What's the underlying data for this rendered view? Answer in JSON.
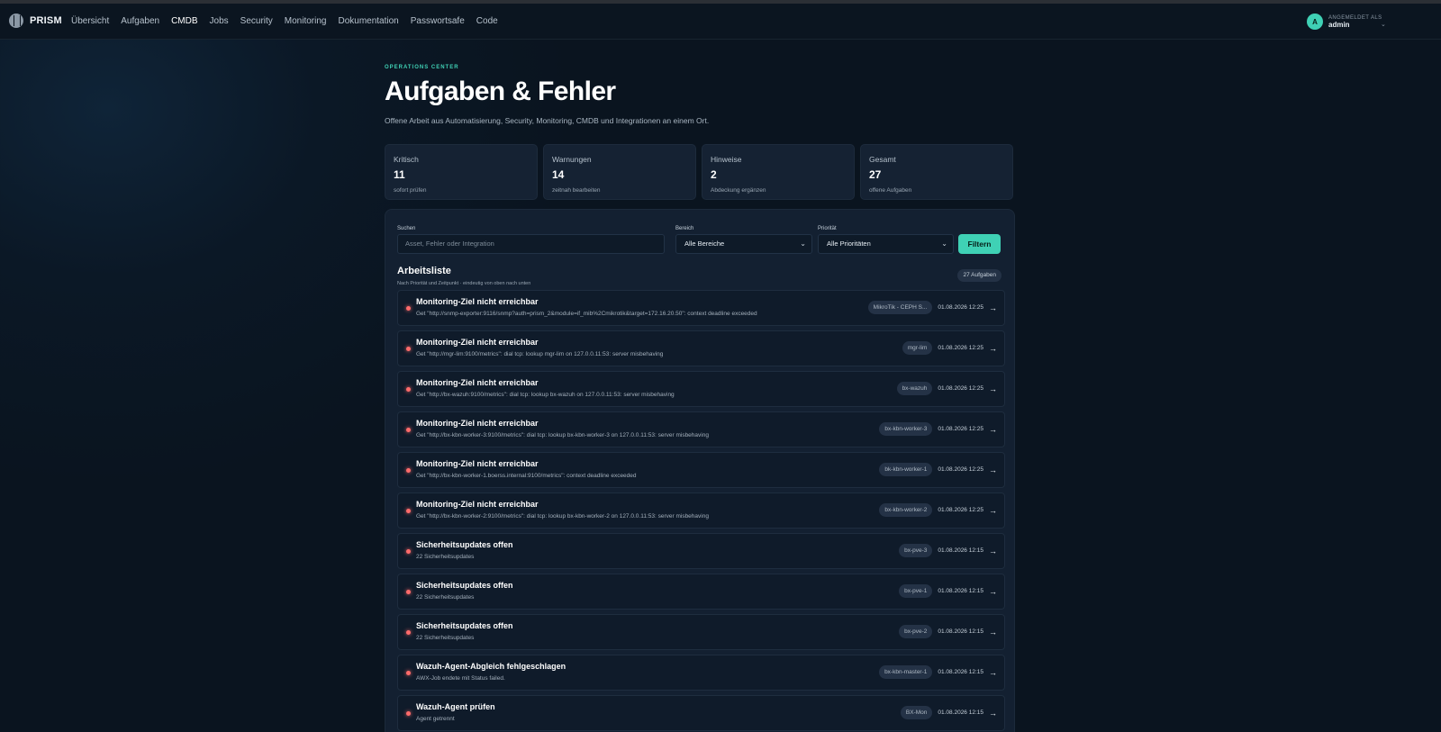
{
  "app": {
    "name": "PRISM"
  },
  "nav": [
    {
      "label": "Übersicht"
    },
    {
      "label": "Aufgaben"
    },
    {
      "label": "CMDB"
    },
    {
      "label": "Jobs"
    },
    {
      "label": "Security"
    },
    {
      "label": "Monitoring"
    },
    {
      "label": "Dokumentation"
    },
    {
      "label": "Passwortsafe"
    },
    {
      "label": "Code"
    }
  ],
  "user": {
    "initial": "A",
    "caption": "ANGEMELDET ALS",
    "name": "admin",
    "chevron": "⌄"
  },
  "header": {
    "eyebrow": "OPERATIONS CENTER",
    "title": "Aufgaben & Fehler",
    "subtitle": "Offene Arbeit aus Automatisierung, Security, Monitoring, CMDB und Integrationen an einem Ort."
  },
  "stats": [
    {
      "label": "Kritisch",
      "value": "11",
      "note": "sofort prüfen"
    },
    {
      "label": "Warnungen",
      "value": "14",
      "note": "zeitnah bearbeiten"
    },
    {
      "label": "Hinweise",
      "value": "2",
      "note": "Abdeckung ergänzen"
    },
    {
      "label": "Gesamt",
      "value": "27",
      "note": "offene Aufgaben"
    }
  ],
  "filters": {
    "search_label": "Suchen",
    "search_placeholder": "Asset, Fehler oder Integration",
    "area_label": "Bereich",
    "area_value": "Alle Bereiche",
    "priority_label": "Priorität",
    "priority_value": "Alle Prioritäten",
    "submit_label": "Filtern"
  },
  "worklist": {
    "title": "Arbeitsliste",
    "subtitle": "Nach Priorität und Zeitpunkt · eindeutig von oben nach unten",
    "count": "27 Aufgaben",
    "arrow": "→",
    "rows": [
      {
        "title": "Monitoring-Ziel nicht erreichbar",
        "desc": "Get \"http://snmp-exporter:9116/snmp?auth=prism_2&module=if_mib%2Cmikrotik&target=172.16.20.50\": context deadline exceeded",
        "tag": "MikroTik - CEPH S...",
        "time": "01.08.2026 12:25"
      },
      {
        "title": "Monitoring-Ziel nicht erreichbar",
        "desc": "Get \"http://mgr-lim:9100/metrics\": dial tcp: lookup mgr-lim on 127.0.0.11:53: server misbehaving",
        "tag": "mgr-lim",
        "time": "01.08.2026 12:25"
      },
      {
        "title": "Monitoring-Ziel nicht erreichbar",
        "desc": "Get \"http://bx-wazuh:9100/metrics\": dial tcp: lookup bx-wazuh on 127.0.0.11:53: server misbehaving",
        "tag": "bx-wazuh",
        "time": "01.08.2026 12:25"
      },
      {
        "title": "Monitoring-Ziel nicht erreichbar",
        "desc": "Get \"http://bx-kbn-worker-3:9100/metrics\": dial tcp: lookup bx-kbn-worker-3 on 127.0.0.11:53: server misbehaving",
        "tag": "bx-kbn-worker-3",
        "time": "01.08.2026 12:25"
      },
      {
        "title": "Monitoring-Ziel nicht erreichbar",
        "desc": "Get \"http://bx-kbn-worker-1.boerss.internal:9100/metrics\": context deadline exceeded",
        "tag": "bk-kbn-worker-1",
        "time": "01.08.2026 12:25"
      },
      {
        "title": "Monitoring-Ziel nicht erreichbar",
        "desc": "Get \"http://bx-kbn-worker-2:9100/metrics\": dial tcp: lookup bx-kbn-worker-2 on 127.0.0.11:53: server misbehaving",
        "tag": "bx-kbn-worker-2",
        "time": "01.08.2026 12:25"
      },
      {
        "title": "Sicherheitsupdates offen",
        "desc": "22 Sicherheitsupdates",
        "tag": "bx-pve-3",
        "time": "01.08.2026 12:15"
      },
      {
        "title": "Sicherheitsupdates offen",
        "desc": "22 Sicherheitsupdates",
        "tag": "bx-pve-1",
        "time": "01.08.2026 12:15"
      },
      {
        "title": "Sicherheitsupdates offen",
        "desc": "22 Sicherheitsupdates",
        "tag": "bx-pve-2",
        "time": "01.08.2026 12:15"
      },
      {
        "title": "Wazuh-Agent-Abgleich fehlgeschlagen",
        "desc": "AWX-Job endete mit Status failed.",
        "tag": "bx-kbn-master-1",
        "time": "01.08.2026 12:15"
      },
      {
        "title": "Wazuh-Agent prüfen",
        "desc": "Agent getrennt",
        "tag": "BX-Mon",
        "time": "01.08.2026 12:15"
      }
    ]
  }
}
